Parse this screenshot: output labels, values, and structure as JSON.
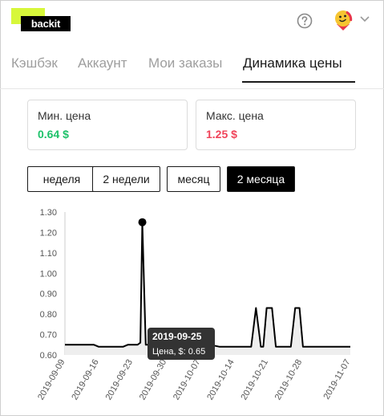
{
  "header": {
    "logo_text": "backit",
    "help_icon": "question-circle-icon",
    "avatar_icon": "user-avatar-icon",
    "dropdown_icon": "chevron-down-icon"
  },
  "tabs": [
    {
      "label": "Кэшбэк",
      "active": false
    },
    {
      "label": "Аккаунт",
      "active": false
    },
    {
      "label": "Мои заказы",
      "active": false
    },
    {
      "label": "Динамика цены",
      "active": true
    }
  ],
  "stats": {
    "min": {
      "label": "Мин. цена",
      "value": "0.64 $",
      "color": "#1ec26a"
    },
    "max": {
      "label": "Макс. цена",
      "value": "1.25 $",
      "color": "#f0445a"
    }
  },
  "periods": [
    {
      "label": "неделя",
      "active": false
    },
    {
      "label": "2 недели",
      "active": false
    },
    {
      "label": "месяц",
      "active": false
    },
    {
      "label": "2 месяца",
      "active": true
    }
  ],
  "chart_data": {
    "type": "area",
    "y_ticks": [
      "1.30",
      "1.20",
      "1.10",
      "1.00",
      "0.90",
      "0.80",
      "0.70",
      "0.60"
    ],
    "ylim": [
      0.6,
      1.3
    ],
    "x_ticks": [
      "2019-09-09",
      "2019-09-16",
      "2019-09-23",
      "2019-09-30",
      "2019-10-07",
      "2019-10-14",
      "2019-10-21",
      "2019-10-28",
      "2019-11-07"
    ],
    "x_tick_days": [
      0,
      7,
      14,
      21,
      28,
      35,
      42,
      49,
      59
    ],
    "xlim_days": [
      0,
      59
    ],
    "points": [
      [
        0,
        0.65
      ],
      [
        6,
        0.65
      ],
      [
        7,
        0.64
      ],
      [
        12,
        0.64
      ],
      [
        13,
        0.65
      ],
      [
        15,
        0.65
      ],
      [
        15.6,
        0.66
      ],
      [
        16,
        1.25
      ],
      [
        16.7,
        0.65
      ],
      [
        22.6,
        0.65
      ],
      [
        25,
        0.65
      ],
      [
        30,
        0.65
      ],
      [
        32,
        0.64
      ],
      [
        38.5,
        0.64
      ],
      [
        39.5,
        0.83
      ],
      [
        40.5,
        0.64
      ],
      [
        41,
        0.64
      ],
      [
        41.7,
        0.83
      ],
      [
        42.8,
        0.83
      ],
      [
        43.6,
        0.64
      ],
      [
        46.7,
        0.64
      ],
      [
        47.6,
        0.83
      ],
      [
        48.5,
        0.83
      ],
      [
        49.2,
        0.64
      ],
      [
        59,
        0.64
      ]
    ],
    "highlight": {
      "day": 16,
      "value": 1.25
    },
    "tooltip": {
      "date": "2019-09-25",
      "text": "Цена, $: 0.65"
    },
    "colors": {
      "line": "#000000",
      "fill": "#eeeeee",
      "tooltip_bg": "#333333"
    }
  }
}
